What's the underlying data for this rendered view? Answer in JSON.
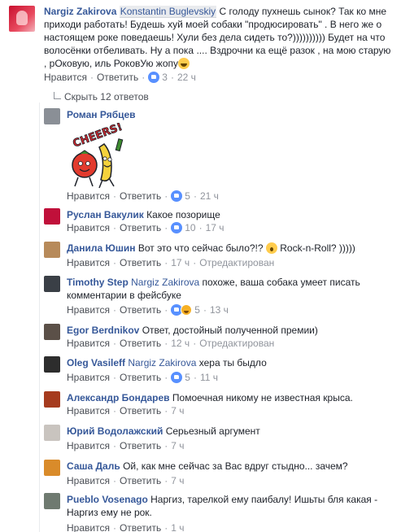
{
  "main_comment": {
    "author": "Nargiz Zakirova",
    "tag": "Konstantin Buglevskiy",
    "text": "С голоду пухнешь сынок? Так ко мне приходи работать! Будешь хуй моей собаки \"продюсировать\" . В него же о настоящем роке поведаешь! Хули без дела сидеть то?)))))))))) Будет на что волосёнки отбеливать. Ну а пока .... Вздрочни ка ещё разок , на мою старую , рОковую, иль РоковУю жопу",
    "like_label": "Нравится",
    "reply_label": "Ответить",
    "likes": "3",
    "time": "22 ч"
  },
  "toggle": {
    "label": "Скрыть 12 ответов"
  },
  "replies": [
    {
      "author": "Роман Рябцев",
      "text": "",
      "like_label": "Нравится",
      "reply_label": "Ответить",
      "likes": "5",
      "time": "21 ч",
      "edited": ""
    },
    {
      "author": "Руслан Вакулик",
      "text": "Какое позорище",
      "like_label": "Нравится",
      "reply_label": "Ответить",
      "likes": "10",
      "time": "17 ч",
      "edited": ""
    },
    {
      "author": "Данила Юшин",
      "text": "Вот это что сейчас было?!?",
      "text2": "Rock-n-Roll? )))))",
      "like_label": "Нравится",
      "reply_label": "Ответить",
      "likes": "",
      "time": "17 ч",
      "edited": "Отредактирован"
    },
    {
      "author": "Timothy Step",
      "tag": "Nargiz Zakirova",
      "text": "похоже, ваша собака умеет писать комментарии в фейсбуке",
      "like_label": "Нравится",
      "reply_label": "Ответить",
      "likes": "5",
      "time": "13 ч",
      "edited": ""
    },
    {
      "author": "Egor Berdnikov",
      "text": "Ответ, достойный полученной премии)",
      "like_label": "Нравится",
      "reply_label": "Ответить",
      "likes": "",
      "time": "12 ч",
      "edited": "Отредактирован"
    },
    {
      "author": "Oleg Vasileff",
      "tag": "Nargiz Zakirova",
      "text": "хера ты быдло",
      "like_label": "Нравится",
      "reply_label": "Ответить",
      "likes": "5",
      "time": "11 ч",
      "edited": ""
    },
    {
      "author": "Александр Бондарев",
      "text": "Помоечная никому не известная крыса.",
      "like_label": "Нравится",
      "reply_label": "Ответить",
      "likes": "",
      "time": "7 ч",
      "edited": ""
    },
    {
      "author": "Юрий Водолажский",
      "text": "Серьезный аргумент",
      "like_label": "Нравится",
      "reply_label": "Ответить",
      "likes": "",
      "time": "7 ч",
      "edited": ""
    },
    {
      "author": "Саша Даль",
      "text": "Ой, как мне сейчас за Вас вдруг стыдно... зачем?",
      "like_label": "Нравится",
      "reply_label": "Ответить",
      "likes": "",
      "time": "7 ч",
      "edited": ""
    },
    {
      "author": "Pueblo Vosenago",
      "text": "Наргиз, тарелкой ему паибалу! Ишьты бля какая - Наргиз ему не рок.",
      "like_label": "Нравится",
      "reply_label": "Ответить",
      "likes": "",
      "time": "1 ч",
      "edited": ""
    }
  ],
  "sticker": {
    "label": "CHEERS!"
  },
  "colors": {
    "link": "#365899",
    "meta": "#90949c",
    "like_blue": "#5890ff"
  }
}
